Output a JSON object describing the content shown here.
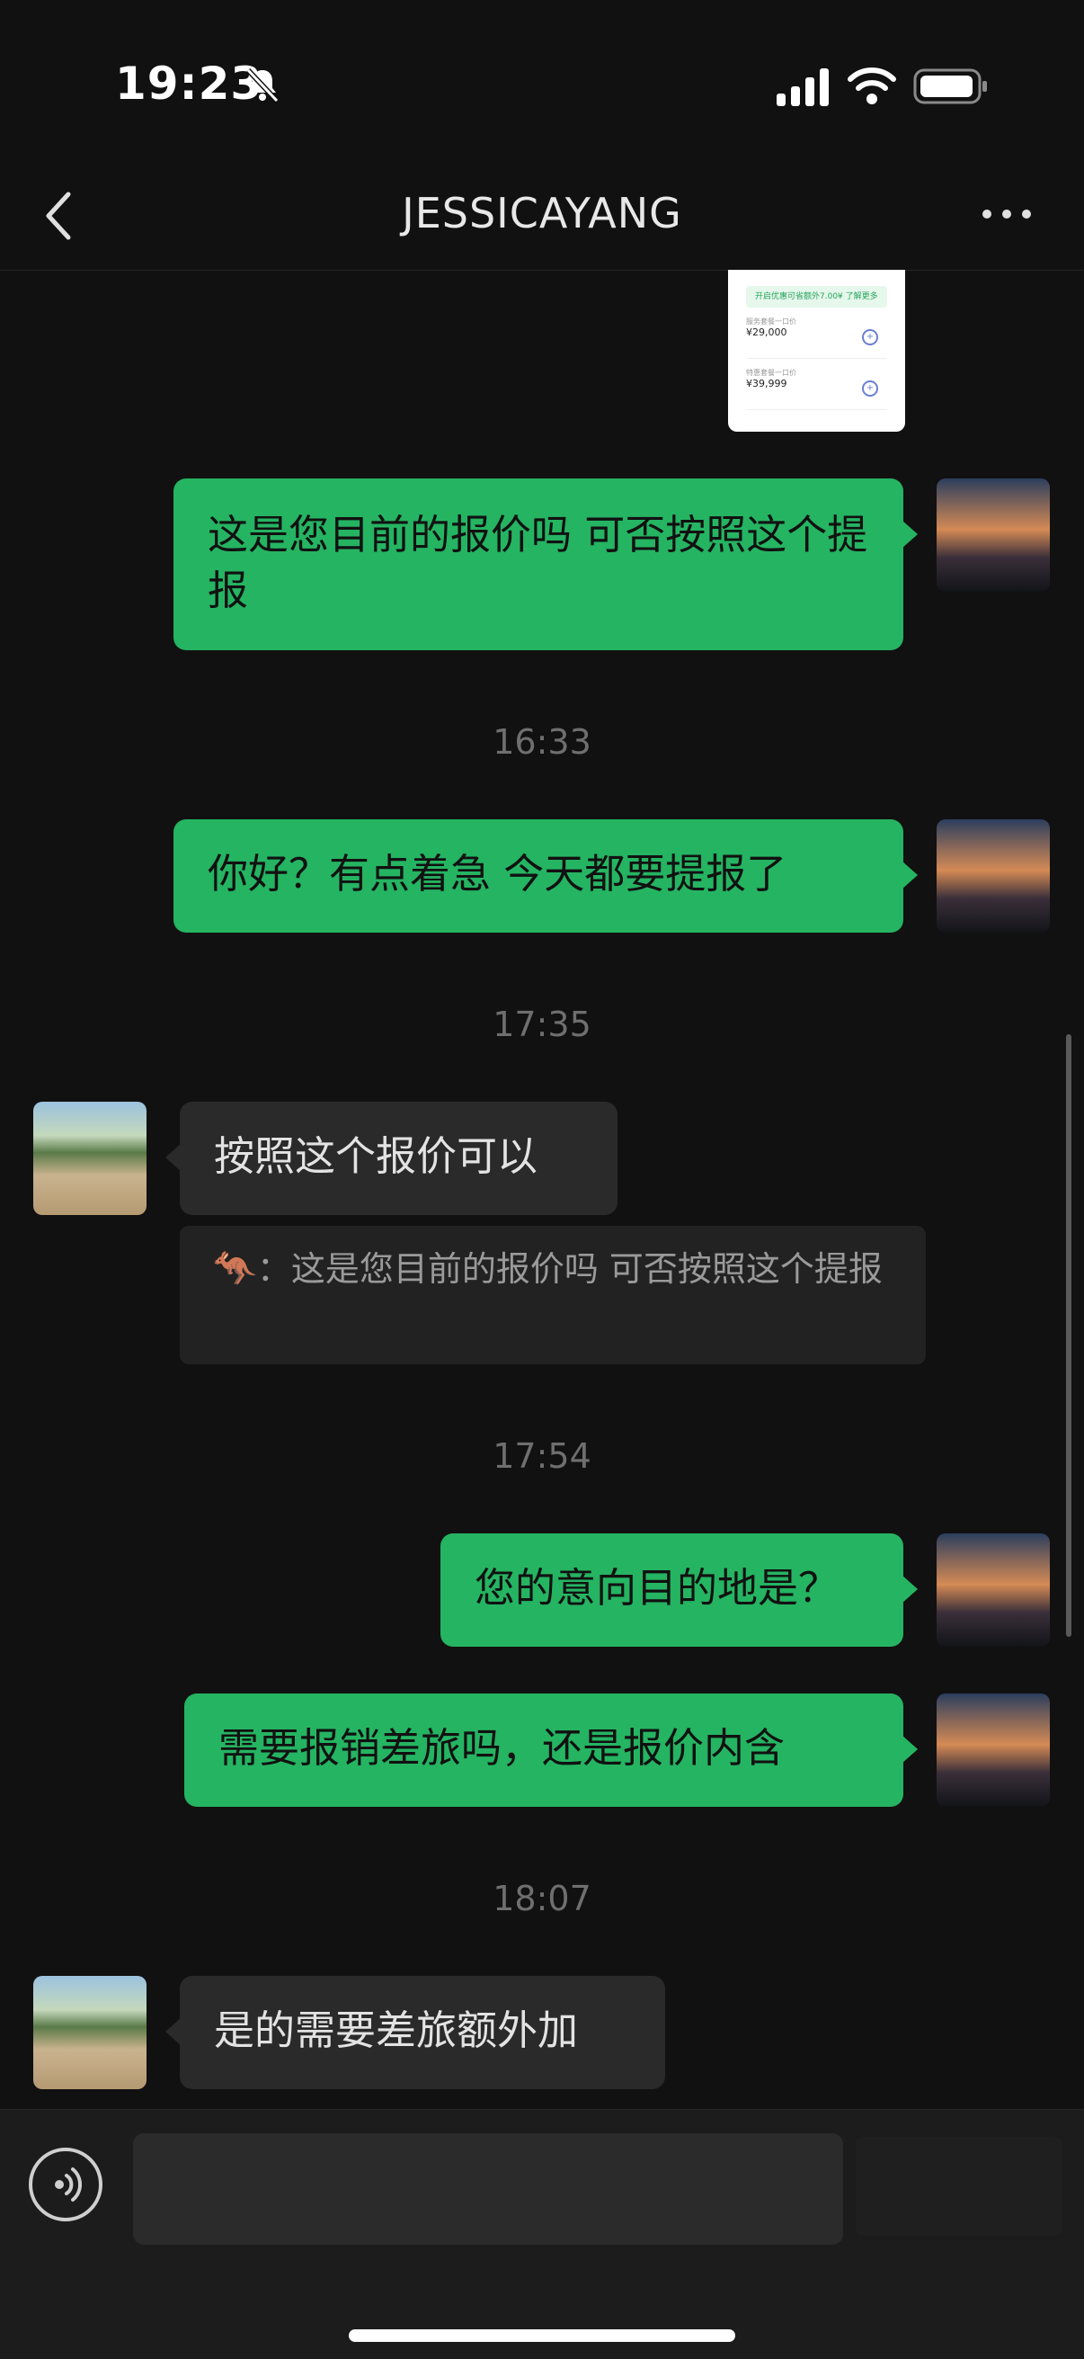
{
  "status_bar": {
    "time": "19:23"
  },
  "header": {
    "title": "JESSICAYANG"
  },
  "shared_image": {
    "banner": "开启优惠可省额外7.00¥ 了解更多",
    "items": [
      {
        "label": "服务套餐一口价",
        "price": "¥29,000"
      },
      {
        "label": "特惠套餐一口价",
        "price": "¥39,999"
      }
    ]
  },
  "messages": {
    "m1": "这是您目前的报价吗 可否按照这个提报",
    "t1": "16:33",
    "m2": "你好？有点着急 今天都要提报了",
    "t2": "17:35",
    "m3": "按照这个报价可以",
    "quote": {
      "sender_emoji": "🦘",
      "text": "：这是您目前的报价吗 可否按照这个提报"
    },
    "t3": "17:54",
    "m4": "您的意向目的地是？",
    "m5": "需要报销差旅吗，还是报价内含",
    "t4": "18:07",
    "m6": "是的需要差旅额外加"
  },
  "colors": {
    "sent_bubble": "#25b462",
    "recv_bubble": "#2a2a2a",
    "background": "#111111"
  }
}
